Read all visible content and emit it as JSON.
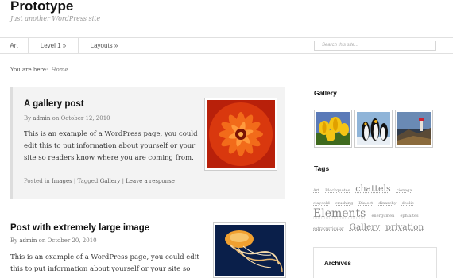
{
  "site": {
    "title": "Prototype",
    "description": "Just another WordPress site"
  },
  "nav": {
    "items": [
      "Art",
      "Level 1 »",
      "Layouts »"
    ],
    "search_placeholder": "Search this site..."
  },
  "breadcrumb": {
    "prefix": "You are here:",
    "current": "Home"
  },
  "posts": [
    {
      "title": "A gallery post",
      "meta_by": "By",
      "author": "admin",
      "meta_on": "on October 12, 2010",
      "excerpt": "This is an example of a WordPress page, you could edit this to put information about yourself or your site so readers know where you are coming from.",
      "footer": {
        "posted_in": "Posted in",
        "category": "Images",
        "sep1": "|",
        "tagged": "Tagged",
        "tag": "Gallery",
        "sep2": "|",
        "response": "Leave a response"
      },
      "thumbnail_icon": "red-flower-image"
    },
    {
      "title": "Post with extremely large image",
      "meta_by": "By",
      "author": "admin",
      "meta_on": "on October 20, 2010",
      "excerpt": "This is an example of a WordPress page, you could edit this to put information about yourself or your site so",
      "thumbnail_icon": "jellyfish-image"
    }
  ],
  "sidebar": {
    "gallery_title": "Gallery",
    "gallery_images": [
      "yellow-tulips-image",
      "penguins-image",
      "lighthouse-image"
    ],
    "tags_title": "Tags",
    "tags": [
      {
        "label": "Art"
      },
      {
        "label": "Blockquotes"
      },
      {
        "label": "chattels"
      },
      {
        "label": "cienaga"
      },
      {
        "label": "claycold"
      },
      {
        "label": "crushing"
      },
      {
        "label": "Dialect"
      },
      {
        "label": "dinarchy"
      },
      {
        "label": "doolie"
      },
      {
        "label": "Elements"
      },
      {
        "label": "energumen"
      },
      {
        "label": "ephialtes"
      },
      {
        "label": "extracurricular"
      },
      {
        "label": "Gallery"
      },
      {
        "label": "privation"
      }
    ],
    "archives_title": "Archives"
  },
  "colors": {
    "post_bg": "#f3f3f3",
    "border": "#e0e0e0",
    "text": "#333333",
    "meta": "#777777"
  }
}
